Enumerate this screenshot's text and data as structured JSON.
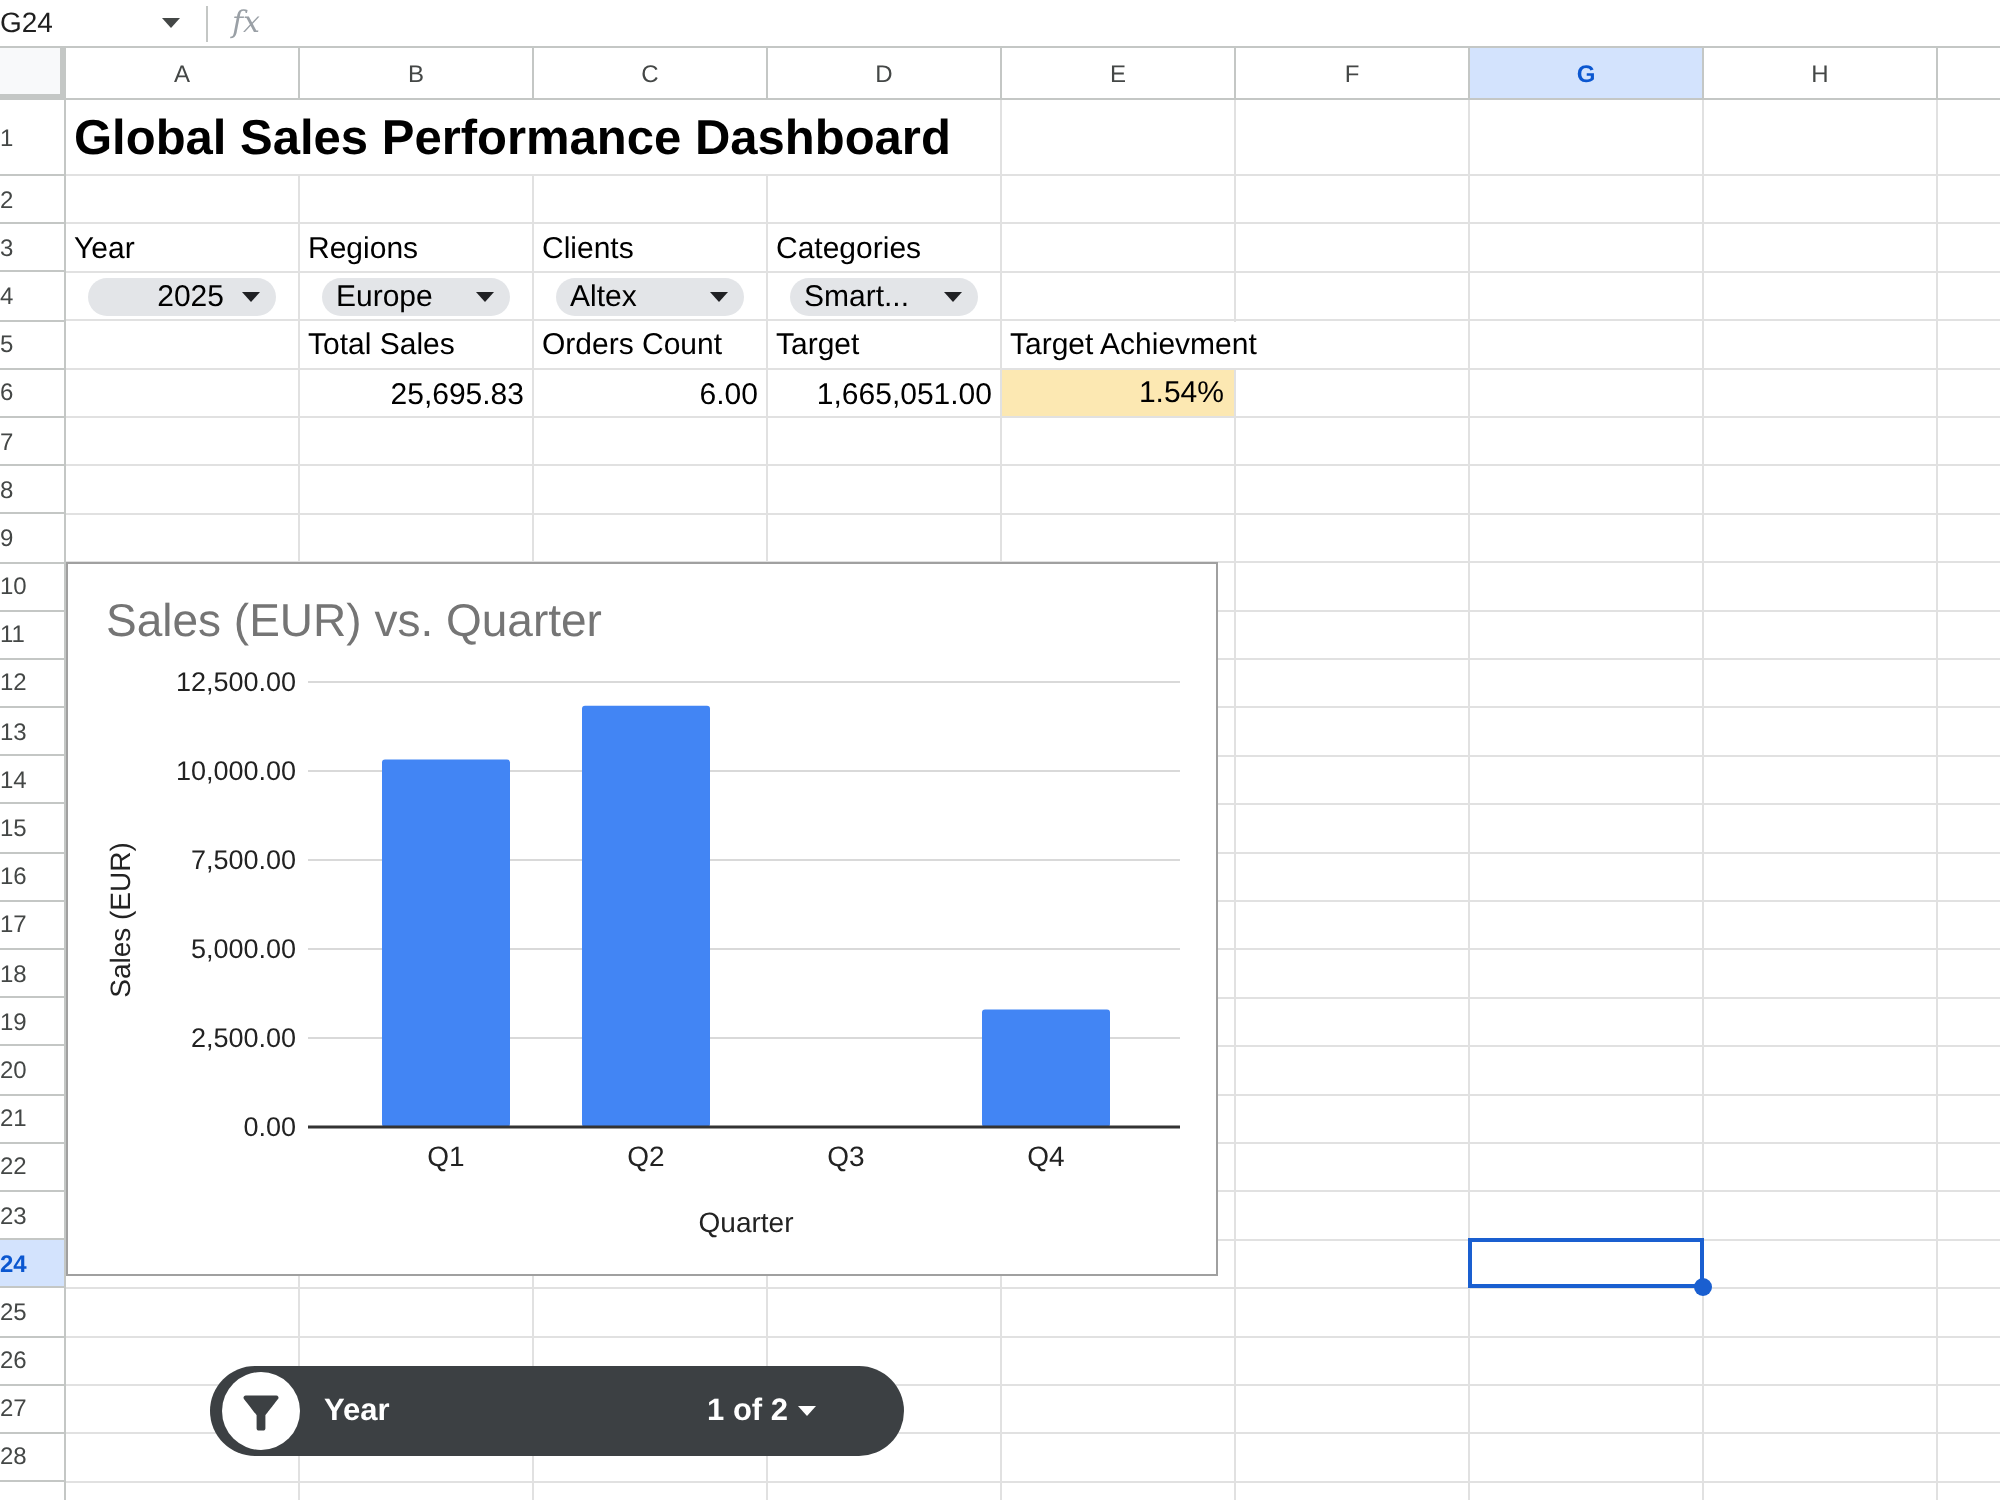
{
  "formula_bar": {
    "name_box": "G24",
    "function_label": "fx"
  },
  "column_headers": [
    {
      "label": "A",
      "selected": false
    },
    {
      "label": "B",
      "selected": false
    },
    {
      "label": "C",
      "selected": false
    },
    {
      "label": "D",
      "selected": false
    },
    {
      "label": "E",
      "selected": false
    },
    {
      "label": "F",
      "selected": false
    },
    {
      "label": "G",
      "selected": true
    },
    {
      "label": "H",
      "selected": false
    }
  ],
  "row_headers": [
    {
      "label": "1",
      "selected": false
    },
    {
      "label": "2",
      "selected": false
    },
    {
      "label": "3",
      "selected": false
    },
    {
      "label": "4",
      "selected": false
    },
    {
      "label": "5",
      "selected": false
    },
    {
      "label": "6",
      "selected": false
    },
    {
      "label": "7",
      "selected": false
    },
    {
      "label": "8",
      "selected": false
    },
    {
      "label": "9",
      "selected": false
    },
    {
      "label": "10",
      "selected": false
    },
    {
      "label": "11",
      "selected": false
    },
    {
      "label": "12",
      "selected": false
    },
    {
      "label": "13",
      "selected": false
    },
    {
      "label": "14",
      "selected": false
    },
    {
      "label": "15",
      "selected": false
    },
    {
      "label": "16",
      "selected": false
    },
    {
      "label": "17",
      "selected": false
    },
    {
      "label": "18",
      "selected": false
    },
    {
      "label": "19",
      "selected": false
    },
    {
      "label": "20",
      "selected": false
    },
    {
      "label": "21",
      "selected": false
    },
    {
      "label": "22",
      "selected": false
    },
    {
      "label": "23",
      "selected": false
    },
    {
      "label": "24",
      "selected": true
    },
    {
      "label": "25",
      "selected": false
    },
    {
      "label": "26",
      "selected": false
    },
    {
      "label": "27",
      "selected": false
    },
    {
      "label": "28",
      "selected": false
    }
  ],
  "title": "Global Sales Performance Dashboard",
  "filters": [
    {
      "label": "Year",
      "value": "2025",
      "kind": "number"
    },
    {
      "label": "Regions",
      "value": "Europe",
      "kind": "text"
    },
    {
      "label": "Clients",
      "value": "Altex",
      "kind": "text"
    },
    {
      "label": "Categories",
      "value": "Smart...",
      "kind": "text"
    }
  ],
  "metrics": [
    {
      "label": "Total Sales",
      "value": "25,695.83",
      "highlighted": false
    },
    {
      "label": "Orders Count",
      "value": "6.00",
      "highlighted": false
    },
    {
      "label": "Target",
      "value": "1,665,051.00",
      "highlighted": false
    },
    {
      "label": "Target Achievment",
      "value": "1.54%",
      "highlighted": true
    }
  ],
  "chart": {
    "chart_data": {
      "type": "bar",
      "title": "Sales (EUR) vs. Quarter",
      "xlabel": "Quarter",
      "ylabel": "Sales (EUR)",
      "categories": [
        "Q1",
        "Q2",
        "Q3",
        "Q4"
      ],
      "series": [
        {
          "color": "#4285f4",
          "values": [
            10320,
            11830,
            null,
            3300
          ]
        }
      ],
      "ylim": [
        0,
        12500
      ],
      "yticks": [
        {
          "value": 0,
          "label": "0.00"
        },
        {
          "value": 2500,
          "label": "2,500.00"
        },
        {
          "value": 5000,
          "label": "5,000.00"
        },
        {
          "value": 7500,
          "label": "7,500.00"
        },
        {
          "value": 10000,
          "label": "10,000.00"
        },
        {
          "value": 12500,
          "label": "12,500.00"
        }
      ],
      "grid": true
    }
  },
  "filter_bar": {
    "label": "Year",
    "position": "1 of 2"
  }
}
